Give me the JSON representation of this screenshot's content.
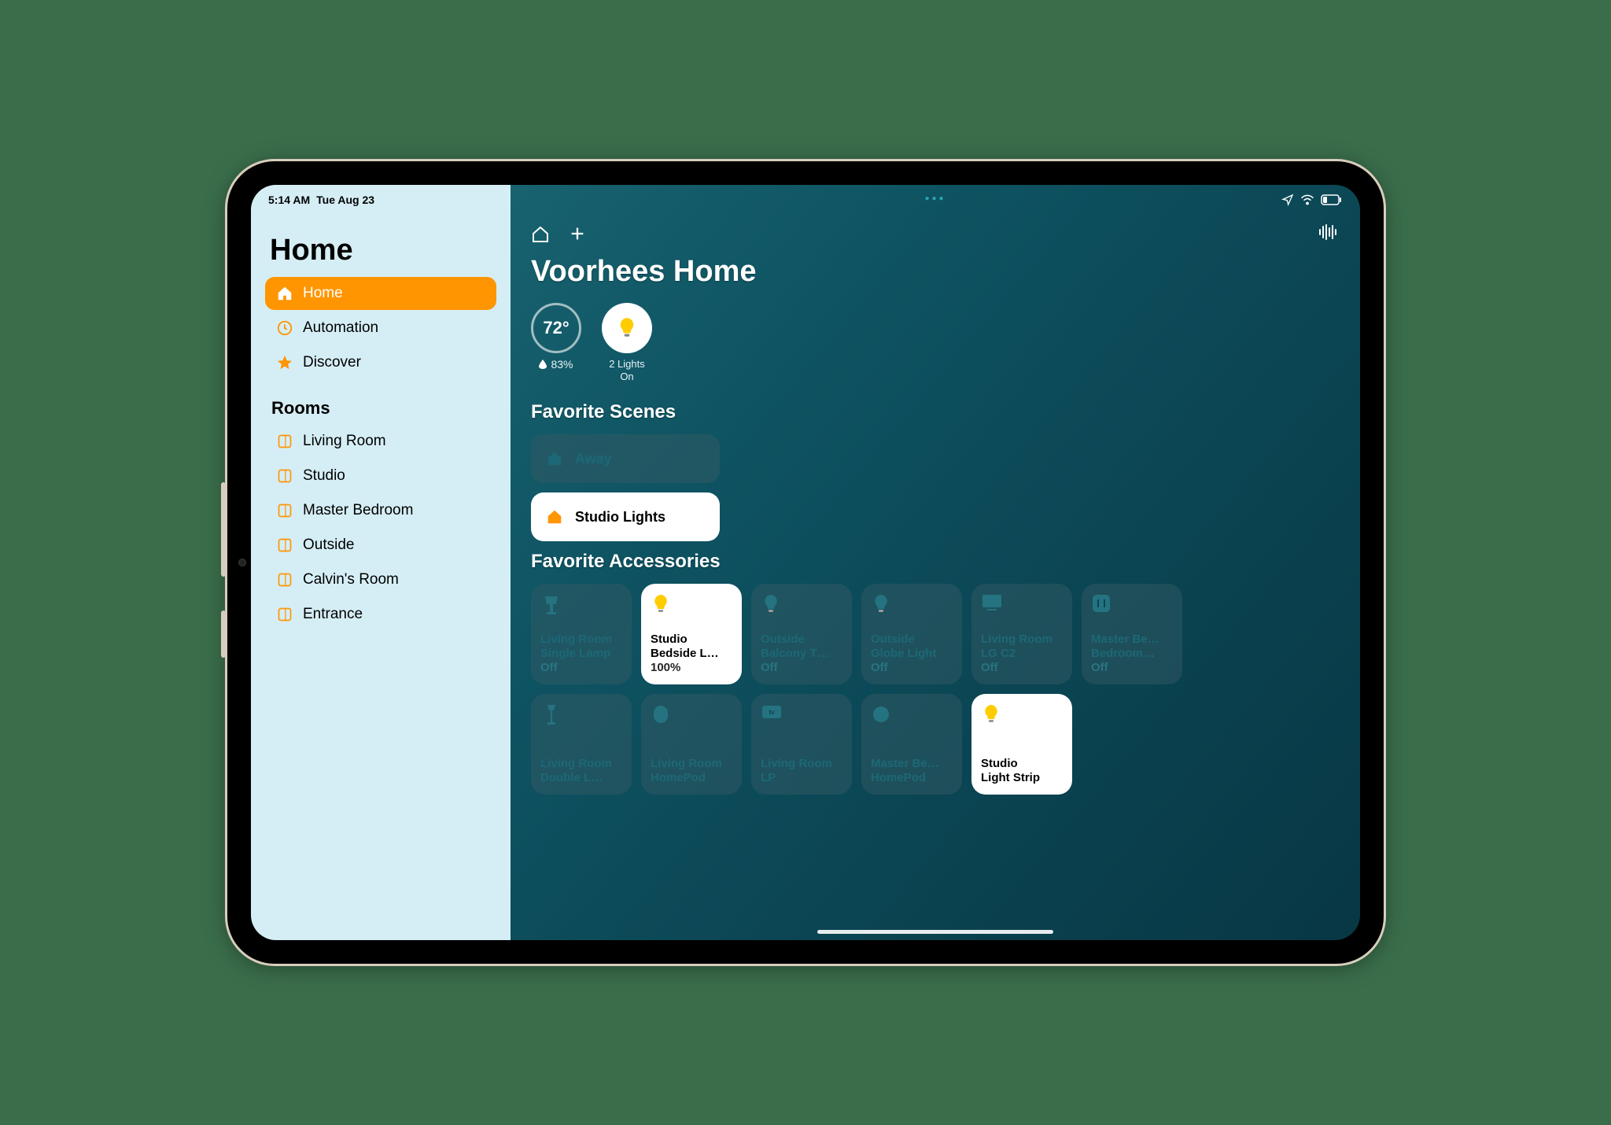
{
  "status": {
    "time": "5:14 AM",
    "date": "Tue Aug 23"
  },
  "sidebar": {
    "title": "Home",
    "nav": [
      {
        "label": "Home",
        "icon": "house"
      },
      {
        "label": "Automation",
        "icon": "clock"
      },
      {
        "label": "Discover",
        "icon": "star"
      }
    ],
    "rooms_header": "Rooms",
    "rooms": [
      {
        "label": "Living Room"
      },
      {
        "label": "Studio"
      },
      {
        "label": "Master Bedroom"
      },
      {
        "label": "Outside"
      },
      {
        "label": "Calvin's Room"
      },
      {
        "label": "Entrance"
      }
    ]
  },
  "main": {
    "title": "Voorhees Home",
    "temp": "72°",
    "humidity": "83%",
    "lights_status": "2 Lights\nOn",
    "scenes_header": "Favorite Scenes",
    "scenes": [
      {
        "label": "Away",
        "on": false,
        "icon": "house"
      },
      {
        "label": "Studio Lights",
        "on": true,
        "icon": "house"
      }
    ],
    "acc_header": "Favorite Accessories",
    "accessories": [
      {
        "l1": "Living Room",
        "l2": "Single Lamp",
        "l3": "Off",
        "on": false,
        "icon": "lamp"
      },
      {
        "l1": "Studio",
        "l2": "Bedside L…",
        "l3": "100%",
        "on": true,
        "icon": "bulb"
      },
      {
        "l1": "Outside",
        "l2": "Balcony T…",
        "l3": "Off",
        "on": false,
        "icon": "bulb"
      },
      {
        "l1": "Outside",
        "l2": "Globe Light",
        "l3": "Off",
        "on": false,
        "icon": "bulb"
      },
      {
        "l1": "Living Room",
        "l2": "LG C2",
        "l3": "Off",
        "on": false,
        "icon": "tv"
      },
      {
        "l1": "Master Be…",
        "l2": "Bedroom…",
        "l3": "Off",
        "on": false,
        "icon": "outlet"
      },
      {
        "l1": "Living Room",
        "l2": "Double L…",
        "l3": "",
        "on": false,
        "icon": "floorlamp"
      },
      {
        "l1": "Living Room",
        "l2": "HomePod",
        "l3": "",
        "on": false,
        "icon": "homepod"
      },
      {
        "l1": "Living Room",
        "l2": "LP",
        "l3": "",
        "on": false,
        "icon": "appletv"
      },
      {
        "l1": "Master Be…",
        "l2": "HomePod",
        "l3": "",
        "on": false,
        "icon": "homepodmini"
      },
      {
        "l1": "Studio",
        "l2": "Light Strip",
        "l3": "",
        "on": true,
        "icon": "bulb"
      }
    ]
  }
}
